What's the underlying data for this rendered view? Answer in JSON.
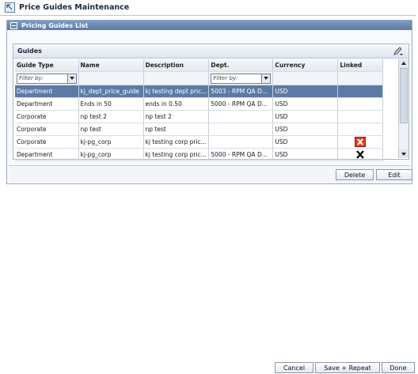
{
  "window": {
    "title": "Price Guides Maintenance"
  },
  "panel": {
    "title": "Pricing Guides List"
  },
  "grid": {
    "title": "Guides",
    "columns": [
      "Guide Type",
      "Name",
      "Description",
      "Dept.",
      "Currency",
      "Linked"
    ],
    "filter_placeholder": "Filter by:",
    "rows": [
      {
        "type": "Department",
        "name": "kj_dept_price_guide",
        "desc": "kj testing dept pric...",
        "dept": "5003 - RPM QA D...",
        "currency": "USD",
        "linked": "",
        "selected": true
      },
      {
        "type": "Department",
        "name": "Ends in 50",
        "desc": "ends in 0.50",
        "dept": "5000 - RPM QA D...",
        "currency": "USD",
        "linked": ""
      },
      {
        "type": "Corporate",
        "name": "np test 2",
        "desc": "np test 2",
        "dept": "",
        "currency": "USD",
        "linked": ""
      },
      {
        "type": "Corporate",
        "name": "np test",
        "desc": "np test",
        "dept": "",
        "currency": "USD",
        "linked": ""
      },
      {
        "type": "Corporate",
        "name": "kj-pg_corp",
        "desc": "kj testing corp pric...",
        "dept": "",
        "currency": "USD",
        "linked": "x-red-icon"
      },
      {
        "type": "Department",
        "name": "kj-pg_corp",
        "desc": "kj testing corp pric...",
        "dept": "5000 - RPM QA D...",
        "currency": "USD",
        "linked": "x-black-icon"
      }
    ]
  },
  "buttons": {
    "delete": "Delete",
    "edit": "Edit",
    "cancel": "Cancel",
    "save_repeat": "Save + Repeat",
    "done": "Done"
  }
}
